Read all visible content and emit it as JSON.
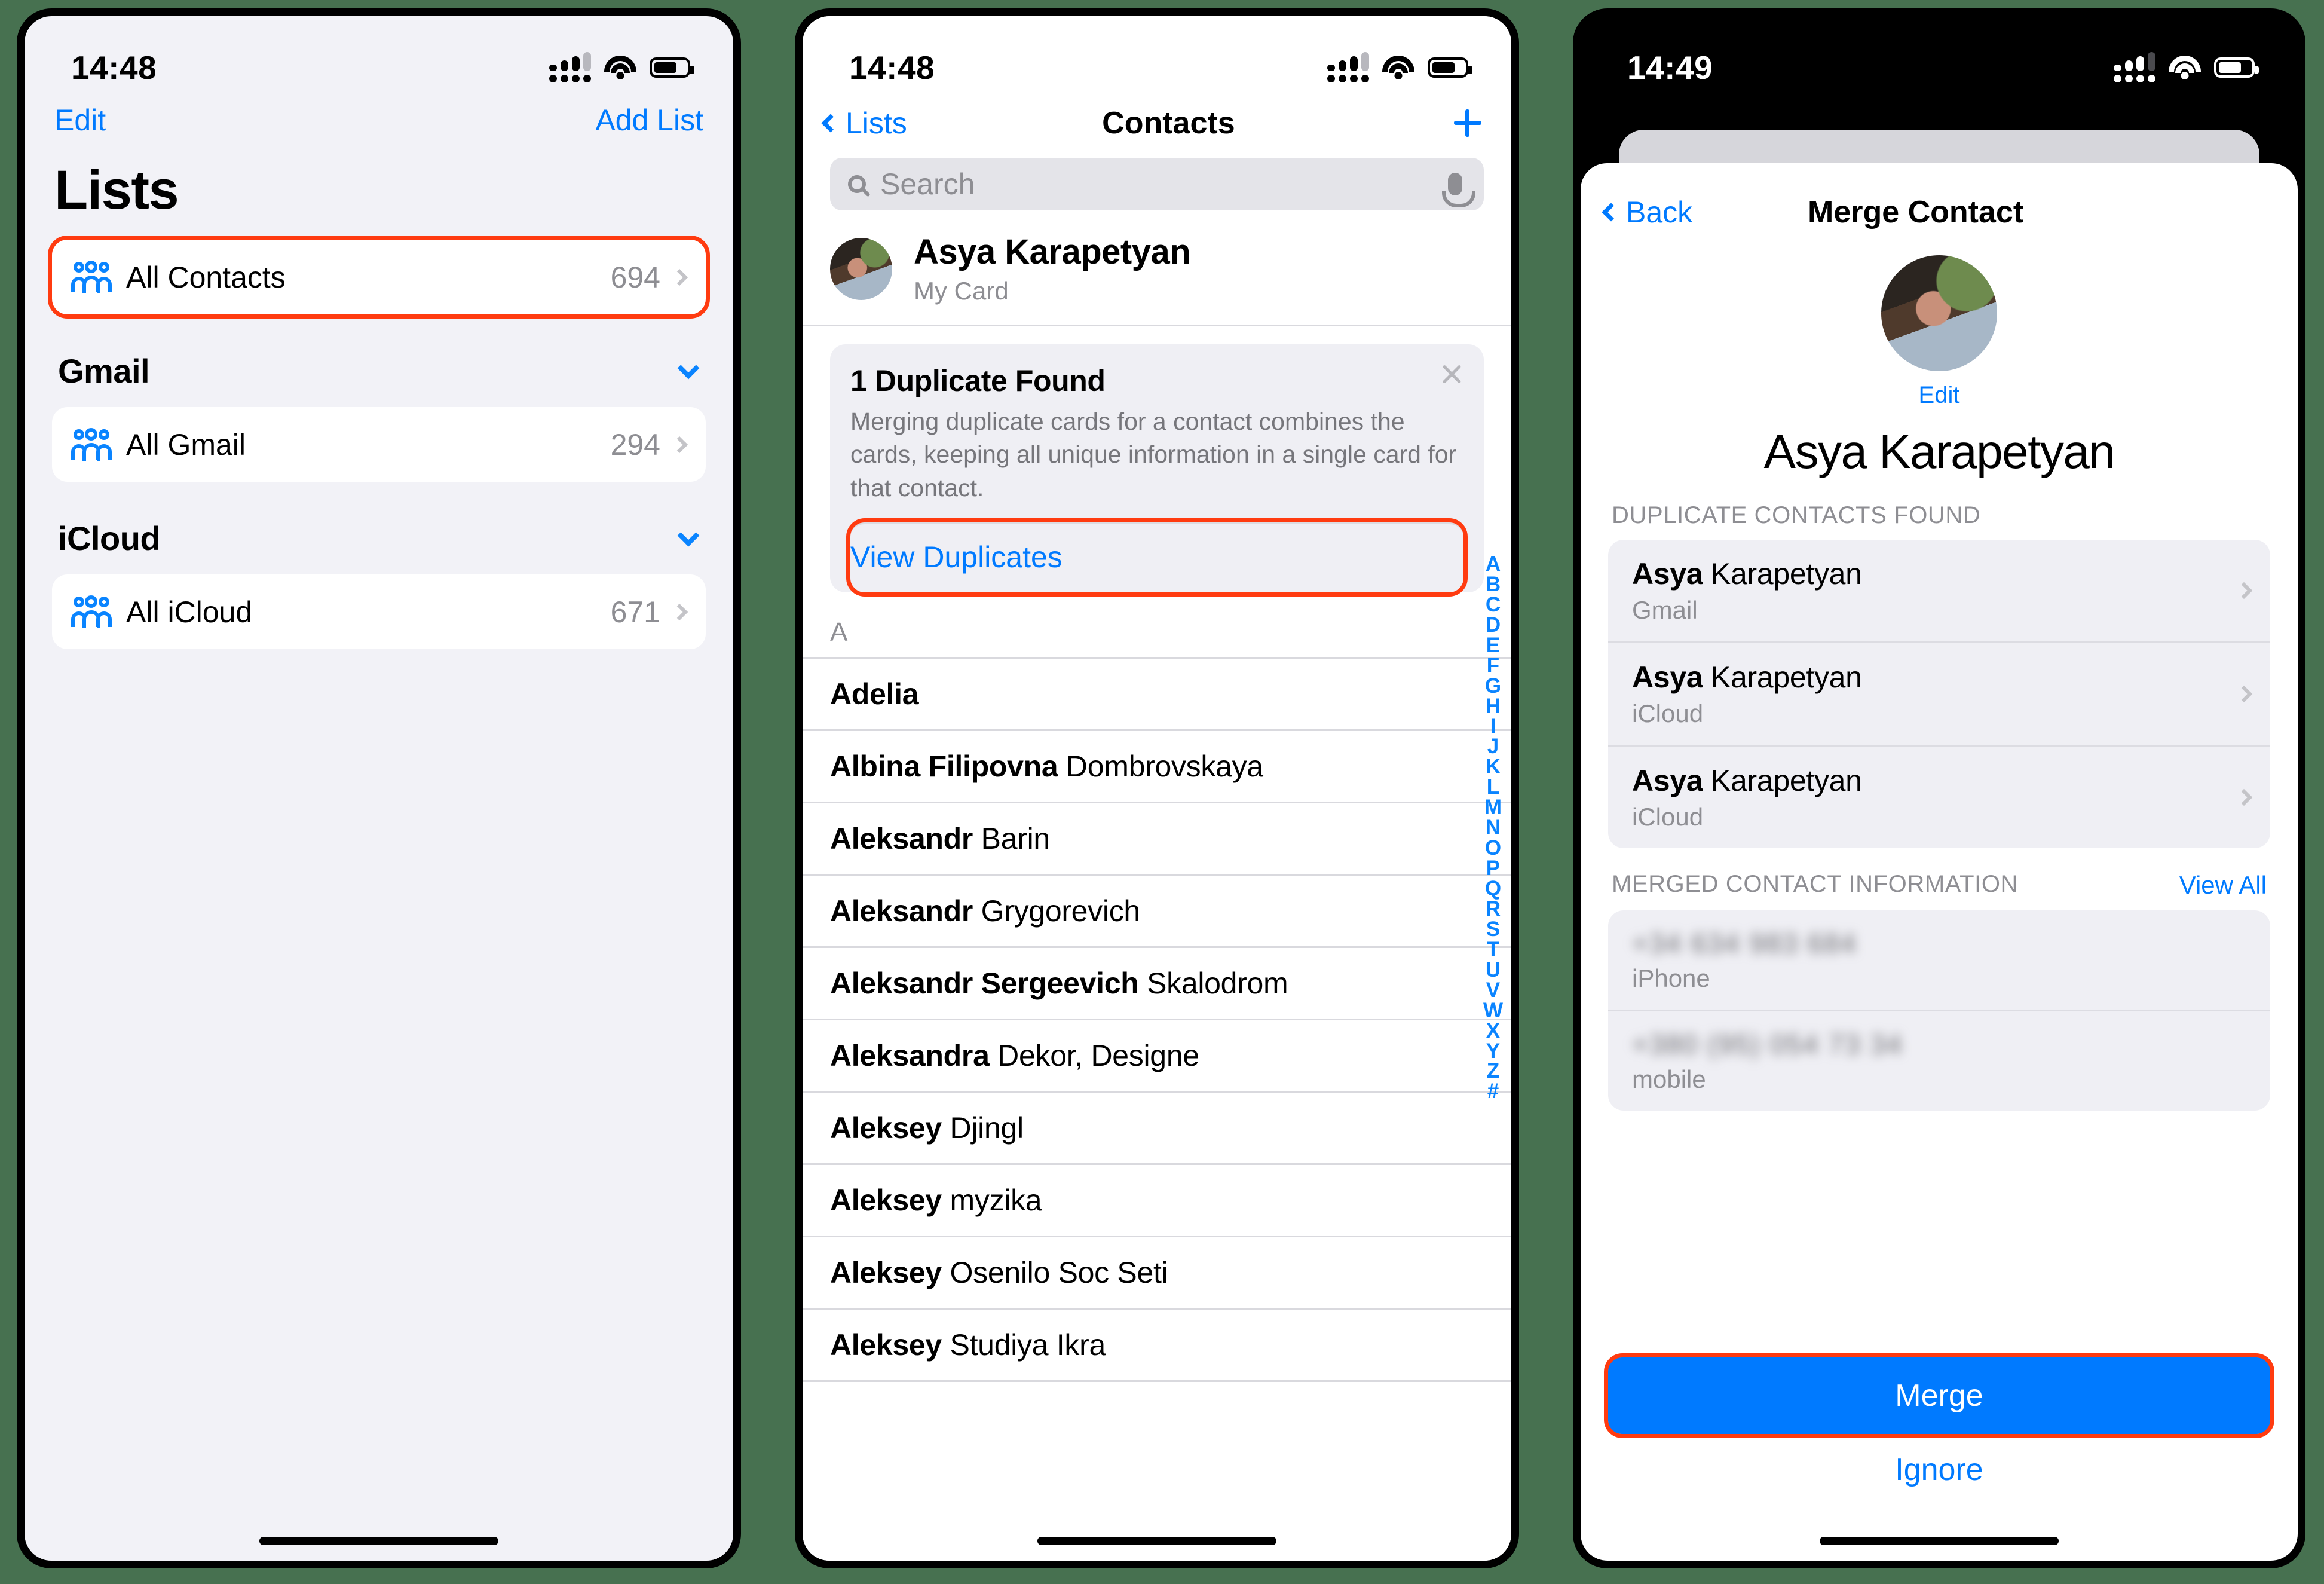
{
  "phone1": {
    "status": {
      "time": "14:48"
    },
    "nav": {
      "edit": "Edit",
      "add_list": "Add List"
    },
    "title": "Lists",
    "sections": [
      {
        "header": null,
        "rows": [
          {
            "label": "All Contacts",
            "count": "694",
            "icon": "people-icon",
            "highlighted": true
          }
        ]
      },
      {
        "header": "Gmail",
        "rows": [
          {
            "label": "All Gmail",
            "count": "294",
            "icon": "people-icon"
          }
        ]
      },
      {
        "header": "iCloud",
        "rows": [
          {
            "label": "All iCloud",
            "count": "671",
            "icon": "people-icon"
          }
        ]
      }
    ]
  },
  "phone2": {
    "status": {
      "time": "14:48"
    },
    "nav": {
      "back": "Lists",
      "title": "Contacts",
      "add": "+"
    },
    "search": {
      "placeholder": "Search"
    },
    "my_card": {
      "name": "Asya Karapetyan",
      "subtitle": "My Card"
    },
    "duplicate_banner": {
      "title": "1 Duplicate Found",
      "body": "Merging duplicate cards for a contact combines the cards, keeping all unique information in a single card for that contact.",
      "action": "View Duplicates",
      "close": "×"
    },
    "section_letter": "A",
    "contacts": [
      {
        "first": "Adelia",
        "last": ""
      },
      {
        "first": "Albina Filipovna",
        "last": "Dombrovskaya"
      },
      {
        "first": "Aleksandr",
        "last": "Barin"
      },
      {
        "first": "Aleksandr",
        "last": "Grygorevich"
      },
      {
        "first": "Aleksandr Sergeevich",
        "last": "Skalodrom"
      },
      {
        "first": "Aleksandra",
        "last": "Dekor, Designe"
      },
      {
        "first": "Aleksey",
        "last": "Djingl"
      },
      {
        "first": "Aleksey",
        "last": "myzika"
      },
      {
        "first": "Aleksey",
        "last": "Osenilo Soc Seti"
      },
      {
        "first": "Aleksey",
        "last": "Studiya Ikra"
      }
    ],
    "alpha_index": [
      "A",
      "B",
      "C",
      "D",
      "E",
      "F",
      "G",
      "H",
      "I",
      "J",
      "K",
      "L",
      "M",
      "N",
      "O",
      "P",
      "Q",
      "R",
      "S",
      "T",
      "U",
      "V",
      "W",
      "X",
      "Y",
      "Z",
      "#"
    ]
  },
  "phone3": {
    "status": {
      "time": "14:49"
    },
    "nav": {
      "back": "Back",
      "title": "Merge Contact"
    },
    "edit": "Edit",
    "name": "Asya Karapetyan",
    "duplicates_header": "DUPLICATE CONTACTS FOUND",
    "duplicates": [
      {
        "first": "Asya",
        "last": "Karapetyan",
        "source": "Gmail"
      },
      {
        "first": "Asya",
        "last": "Karapetyan",
        "source": "iCloud"
      },
      {
        "first": "Asya",
        "last": "Karapetyan",
        "source": "iCloud"
      }
    ],
    "merged_header": "MERGED CONTACT INFORMATION",
    "view_all": "View All",
    "merged_fields": [
      {
        "value": "+34 634 983 684",
        "label": "iPhone"
      },
      {
        "value": "+380 (95) 054 73 34",
        "label": "mobile"
      }
    ],
    "merge_button": "Merge",
    "ignore_button": "Ignore"
  },
  "colors": {
    "accent": "#007AFF",
    "highlight": "#FF3B10",
    "background": "#477150"
  }
}
